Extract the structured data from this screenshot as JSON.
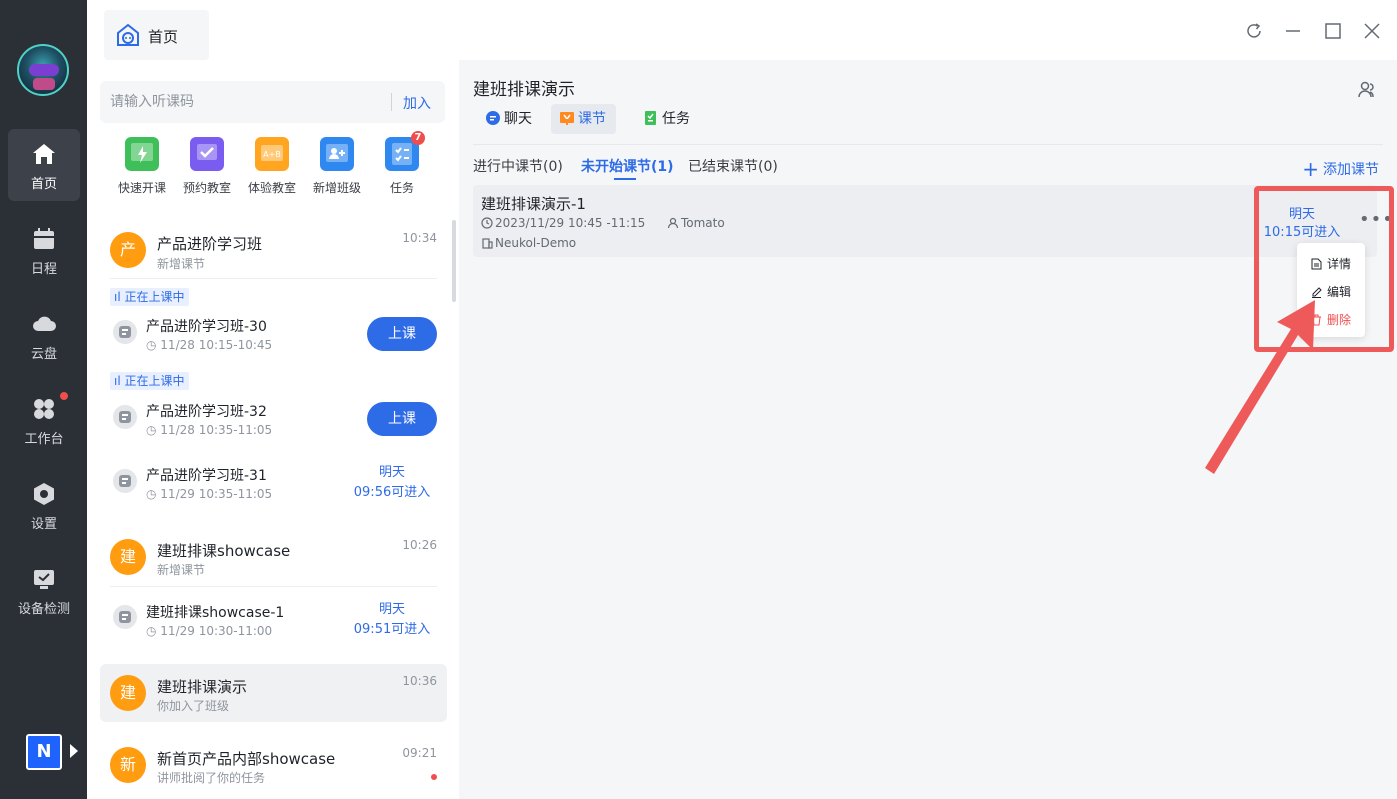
{
  "titlebar": {
    "home_tab": "首页"
  },
  "rail": {
    "items": [
      {
        "label": "首页",
        "icon": "home-icon"
      },
      {
        "label": "日程",
        "icon": "calendar-icon"
      },
      {
        "label": "云盘",
        "icon": "cloud-icon"
      },
      {
        "label": "工作台",
        "icon": "workbench-icon"
      },
      {
        "label": "设置",
        "icon": "settings-icon"
      },
      {
        "label": "设备检测",
        "icon": "device-check-icon"
      }
    ],
    "logo": "N"
  },
  "search": {
    "placeholder": "请输入听课码",
    "join_label": "加入"
  },
  "quick_actions": [
    {
      "label": "快速开课",
      "color": "#3fbf5a"
    },
    {
      "label": "预约教室",
      "color": "#7b5cf0"
    },
    {
      "label": "体验教室",
      "color": "#ffa51f"
    },
    {
      "label": "新增班级",
      "color": "#2e88f0"
    },
    {
      "label": "任务",
      "color": "#2e88f0",
      "badge": "7"
    }
  ],
  "list": {
    "group1": {
      "avatar": "产",
      "title": "产品进阶学习班",
      "sub": "新增课节",
      "time": "10:34"
    },
    "live_label": "正在上课中",
    "s1": {
      "title": "产品进阶学习班-30",
      "time": "11/28 10:15-10:45",
      "button": "上课"
    },
    "s2": {
      "title": "产品进阶学习班-32",
      "time": "11/28 10:35-11:05",
      "button": "上课"
    },
    "s3": {
      "title": "产品进阶学习班-31",
      "time": "11/29 10:35-11:05",
      "enter_day": "明天",
      "enter_time": "09:56可进入"
    },
    "group2": {
      "avatar": "建",
      "title": "建班排课showcase",
      "sub": "新增课节",
      "time": "10:26"
    },
    "s4": {
      "title": "建班排课showcase-1",
      "time": "11/29 10:30-11:00",
      "enter_day": "明天",
      "enter_time": "09:51可进入"
    },
    "group3": {
      "avatar": "建",
      "title": "建班排课演示",
      "sub": "你加入了班级",
      "time": "10:36"
    },
    "group4": {
      "avatar": "新",
      "title": "新首页产品内部showcase",
      "sub": "讲师批阅了你的任务",
      "time": "09:21"
    }
  },
  "panel": {
    "title": "建班排课演示",
    "tabs": [
      "聊天",
      "课节",
      "任务"
    ],
    "sub_tabs": [
      "进行中课节(0)",
      "未开始课节(1)",
      "已结束课节(0)"
    ],
    "add_label": "添加课节",
    "card": {
      "title": "建班排课演示-1",
      "time": "2023/11/29 10:45 -11:15",
      "teacher": "Tomato",
      "org": "Neukol-Demo",
      "enter_day": "明天",
      "enter_time": "10:15可进入"
    },
    "menu": [
      "详情",
      "编辑",
      "删除"
    ]
  },
  "colors": {
    "accent": "#2e6be6",
    "annotation": "#ee5a5a",
    "rail": "#2b2f36"
  }
}
